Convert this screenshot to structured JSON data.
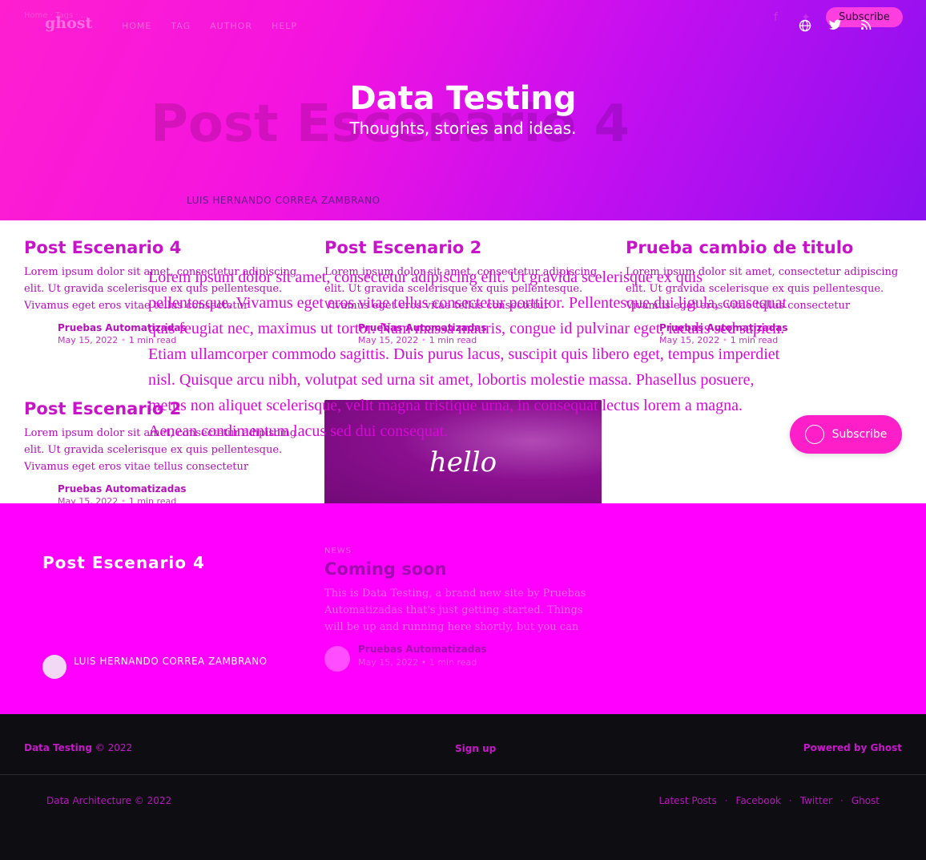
{
  "hero": {
    "top_menu": "Home · Tags · ...",
    "logo": "ghost",
    "nav": [
      "HOME",
      "TAG",
      "AUTHOR",
      "HELP"
    ],
    "subscribe_label": "Subscribe",
    "title": "Data Testing",
    "description": "Thoughts, stories and ideas.",
    "overlay_title": "Post Escenario 4",
    "author": "LUIS HERNANDO CORREA ZAMBRANO",
    "social_icons": [
      "globe-icon",
      "twitter-icon",
      "rss-icon"
    ]
  },
  "cards": [
    {
      "title": "Post Escenario 4",
      "excerpt": "Lorem ipsum dolor sit amet, consectetur adipiscing elit. Ut gravida scelerisque ex quis pellentesque. Vivamus eget eros vitae tellus consectetur porttitor.…",
      "author": "Pruebas Automatizadas",
      "date": "May 15, 2022",
      "read": "1 min read"
    },
    {
      "title": "Post Escenario 2",
      "excerpt": "Lorem ipsum dolor sit amet, consectetur adipiscing elit. Ut gravida scelerisque ex quis pellentesque. Vivamus eget eros vitae tellus consectetur porttitor.…",
      "author": "Pruebas Automatizadas",
      "date": "May 15, 2022",
      "read": "1 min read"
    },
    {
      "title": "Prueba cambio de titulo",
      "excerpt": "Lorem ipsum dolor sit amet, consectetur adipiscing elit. Ut gravida scelerisque ex quis pellentesque. Vivamus eget eros vitae tellus consectetur porttitor.…",
      "author": "Pruebas Automatizadas",
      "date": "May 15, 2022",
      "read": "1 min read"
    },
    {
      "title": "Post Escenario 2",
      "excerpt": "Lorem ipsum dolor sit amet, consectetur adipiscing elit. Ut gravida scelerisque ex quis pellentesque. Vivamus eget eros vitae tellus consectetur porttitor.…",
      "author": "Pruebas Automatizadas",
      "date": "May 15, 2022",
      "read": "1 min read"
    }
  ],
  "overlay_paragraph": "Lorem ipsum dolor sit amet, consectetur adipiscing elit. Ut gravida scelerisque ex quis pellentesque. Vivamus eget eros vitae tellus consectetur porttitor. Pellentesque dui ligula, consequat quis feugiat nec, maximus ut tortor. Nam massa mauris, congue id pulvinar eget, iaculis sed sapien. Etiam ullamcorper commodo sagittis. Duis purus lacus, suscipit quis libero eget, tempus imperdiet nisl. Quisque arcu nibh, volutpat sed urna sit amet, lobortis molestie massa. Phasellus posuere, metus non aliquet scelerisque, velit magna tristique urna, in consequat lectus lorem a magna. Aenean condimentum lacus sed dui consequat.",
  "feature_image": {
    "text": "hello"
  },
  "subscribe_float_label": "Subscribe",
  "band": {
    "title": "Post Escenario 4",
    "author": "LUIS HERNANDO CORREA ZAMBRANO",
    "coming": {
      "tag": "NEWS",
      "title": "Coming soon",
      "excerpt": "This is Data Testing, a brand new site by Pruebas Automatizadas that's just getting started. Things will be up and running here shortly, but you can subscri…",
      "author": "Pruebas Automatizadas",
      "date": "May 15, 2022",
      "read": "1 min read"
    }
  },
  "footer": {
    "site": "Data Testing",
    "copyright": "© 2022",
    "signup": "Sign up",
    "powered": "Powered by Ghost",
    "bottom_left": "Data Architecture © 2022",
    "links": [
      "Latest Posts",
      "Facebook",
      "Twitter",
      "Ghost"
    ]
  },
  "colors": {
    "hero_start": "#ff1fd0",
    "hero_end": "#8a11f0",
    "band": "#ff00ff",
    "accent": "#c714c9",
    "footer_bg": "#0e0e12"
  }
}
